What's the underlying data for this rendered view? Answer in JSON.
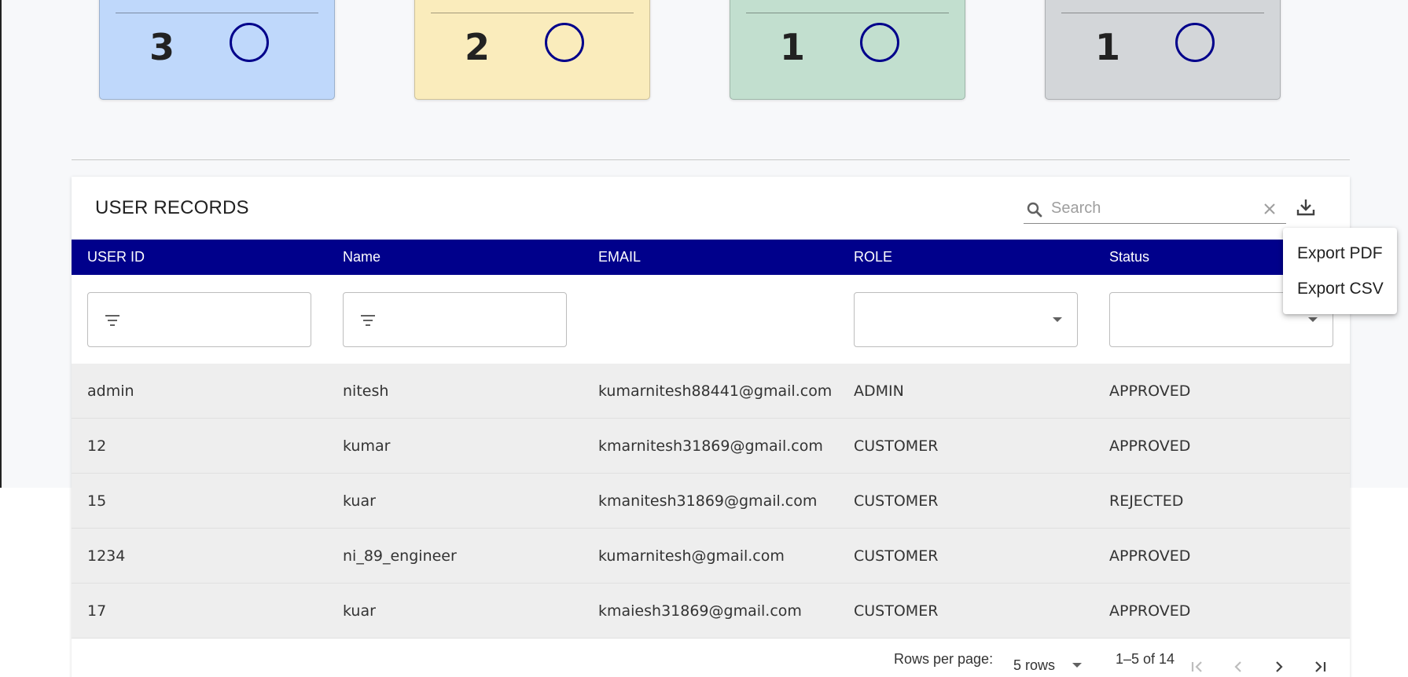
{
  "summary_cards": [
    {
      "count": "3",
      "color": "#bfd8fb"
    },
    {
      "count": "2",
      "color": "#faecbc"
    },
    {
      "count": "1",
      "color": "#c2dfcf"
    },
    {
      "count": "1",
      "color": "#d3d6d9"
    }
  ],
  "table": {
    "title": "USER RECORDS",
    "search_placeholder": "Search",
    "columns": [
      "USER ID",
      "Name",
      "EMAIL",
      "ROLE",
      "Status"
    ],
    "header_color": "#00008b",
    "rows": [
      {
        "user_id": "admin",
        "name": "nitesh",
        "email": "kumarnitesh88441@gmail.com",
        "role": "ADMIN",
        "status": "APPROVED"
      },
      {
        "user_id": "12",
        "name": "kumar",
        "email": "kmarnitesh31869@gmail.com",
        "role": "CUSTOMER",
        "status": "APPROVED"
      },
      {
        "user_id": "15",
        "name": "kuar",
        "email": "kmanitesh31869@gmail.com",
        "role": "CUSTOMER",
        "status": "REJECTED"
      },
      {
        "user_id": "1234",
        "name": "ni_89_engineer",
        "email": "kumarnitesh@gmail.com",
        "role": "CUSTOMER",
        "status": "APPROVED"
      },
      {
        "user_id": "17",
        "name": "kuar",
        "email": "kmaiesh31869@gmail.com",
        "role": "CUSTOMER",
        "status": "APPROVED"
      }
    ],
    "pagination": {
      "rows_per_page_label": "Rows per page:",
      "rows_per_page_value": "5 rows",
      "range": "1–5 of 14"
    }
  },
  "export_menu": {
    "items": [
      "Export PDF",
      "Export CSV"
    ]
  },
  "icons": [
    "search-icon",
    "clear-icon",
    "download-icon",
    "filter-icon",
    "dropdown-arrow-icon",
    "first-page-icon",
    "previous-page-icon",
    "next-page-icon",
    "last-page-icon"
  ]
}
